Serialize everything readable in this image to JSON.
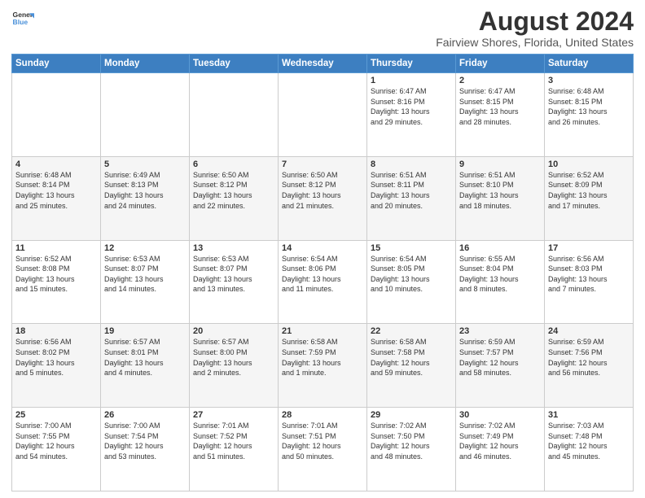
{
  "logo": {
    "line1": "General",
    "line2": "Blue"
  },
  "title": "August 2024",
  "subtitle": "Fairview Shores, Florida, United States",
  "days_header": [
    "Sunday",
    "Monday",
    "Tuesday",
    "Wednesday",
    "Thursday",
    "Friday",
    "Saturday"
  ],
  "weeks": [
    [
      {
        "day": "",
        "info": ""
      },
      {
        "day": "",
        "info": ""
      },
      {
        "day": "",
        "info": ""
      },
      {
        "day": "",
        "info": ""
      },
      {
        "day": "1",
        "info": "Sunrise: 6:47 AM\nSunset: 8:16 PM\nDaylight: 13 hours\nand 29 minutes."
      },
      {
        "day": "2",
        "info": "Sunrise: 6:47 AM\nSunset: 8:15 PM\nDaylight: 13 hours\nand 28 minutes."
      },
      {
        "day": "3",
        "info": "Sunrise: 6:48 AM\nSunset: 8:15 PM\nDaylight: 13 hours\nand 26 minutes."
      }
    ],
    [
      {
        "day": "4",
        "info": "Sunrise: 6:48 AM\nSunset: 8:14 PM\nDaylight: 13 hours\nand 25 minutes."
      },
      {
        "day": "5",
        "info": "Sunrise: 6:49 AM\nSunset: 8:13 PM\nDaylight: 13 hours\nand 24 minutes."
      },
      {
        "day": "6",
        "info": "Sunrise: 6:50 AM\nSunset: 8:12 PM\nDaylight: 13 hours\nand 22 minutes."
      },
      {
        "day": "7",
        "info": "Sunrise: 6:50 AM\nSunset: 8:12 PM\nDaylight: 13 hours\nand 21 minutes."
      },
      {
        "day": "8",
        "info": "Sunrise: 6:51 AM\nSunset: 8:11 PM\nDaylight: 13 hours\nand 20 minutes."
      },
      {
        "day": "9",
        "info": "Sunrise: 6:51 AM\nSunset: 8:10 PM\nDaylight: 13 hours\nand 18 minutes."
      },
      {
        "day": "10",
        "info": "Sunrise: 6:52 AM\nSunset: 8:09 PM\nDaylight: 13 hours\nand 17 minutes."
      }
    ],
    [
      {
        "day": "11",
        "info": "Sunrise: 6:52 AM\nSunset: 8:08 PM\nDaylight: 13 hours\nand 15 minutes."
      },
      {
        "day": "12",
        "info": "Sunrise: 6:53 AM\nSunset: 8:07 PM\nDaylight: 13 hours\nand 14 minutes."
      },
      {
        "day": "13",
        "info": "Sunrise: 6:53 AM\nSunset: 8:07 PM\nDaylight: 13 hours\nand 13 minutes."
      },
      {
        "day": "14",
        "info": "Sunrise: 6:54 AM\nSunset: 8:06 PM\nDaylight: 13 hours\nand 11 minutes."
      },
      {
        "day": "15",
        "info": "Sunrise: 6:54 AM\nSunset: 8:05 PM\nDaylight: 13 hours\nand 10 minutes."
      },
      {
        "day": "16",
        "info": "Sunrise: 6:55 AM\nSunset: 8:04 PM\nDaylight: 13 hours\nand 8 minutes."
      },
      {
        "day": "17",
        "info": "Sunrise: 6:56 AM\nSunset: 8:03 PM\nDaylight: 13 hours\nand 7 minutes."
      }
    ],
    [
      {
        "day": "18",
        "info": "Sunrise: 6:56 AM\nSunset: 8:02 PM\nDaylight: 13 hours\nand 5 minutes."
      },
      {
        "day": "19",
        "info": "Sunrise: 6:57 AM\nSunset: 8:01 PM\nDaylight: 13 hours\nand 4 minutes."
      },
      {
        "day": "20",
        "info": "Sunrise: 6:57 AM\nSunset: 8:00 PM\nDaylight: 13 hours\nand 2 minutes."
      },
      {
        "day": "21",
        "info": "Sunrise: 6:58 AM\nSunset: 7:59 PM\nDaylight: 13 hours\nand 1 minute."
      },
      {
        "day": "22",
        "info": "Sunrise: 6:58 AM\nSunset: 7:58 PM\nDaylight: 12 hours\nand 59 minutes."
      },
      {
        "day": "23",
        "info": "Sunrise: 6:59 AM\nSunset: 7:57 PM\nDaylight: 12 hours\nand 58 minutes."
      },
      {
        "day": "24",
        "info": "Sunrise: 6:59 AM\nSunset: 7:56 PM\nDaylight: 12 hours\nand 56 minutes."
      }
    ],
    [
      {
        "day": "25",
        "info": "Sunrise: 7:00 AM\nSunset: 7:55 PM\nDaylight: 12 hours\nand 54 minutes."
      },
      {
        "day": "26",
        "info": "Sunrise: 7:00 AM\nSunset: 7:54 PM\nDaylight: 12 hours\nand 53 minutes."
      },
      {
        "day": "27",
        "info": "Sunrise: 7:01 AM\nSunset: 7:52 PM\nDaylight: 12 hours\nand 51 minutes."
      },
      {
        "day": "28",
        "info": "Sunrise: 7:01 AM\nSunset: 7:51 PM\nDaylight: 12 hours\nand 50 minutes."
      },
      {
        "day": "29",
        "info": "Sunrise: 7:02 AM\nSunset: 7:50 PM\nDaylight: 12 hours\nand 48 minutes."
      },
      {
        "day": "30",
        "info": "Sunrise: 7:02 AM\nSunset: 7:49 PM\nDaylight: 12 hours\nand 46 minutes."
      },
      {
        "day": "31",
        "info": "Sunrise: 7:03 AM\nSunset: 7:48 PM\nDaylight: 12 hours\nand 45 minutes."
      }
    ]
  ]
}
